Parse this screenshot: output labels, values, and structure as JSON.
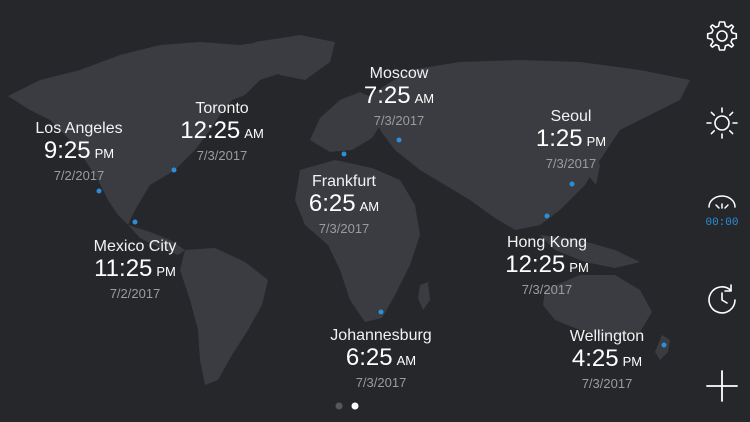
{
  "cities": [
    {
      "name": "Los Angeles",
      "time": "9:25",
      "ampm": "PM",
      "date": "7/2/2017"
    },
    {
      "name": "Toronto",
      "time": "12:25",
      "ampm": "AM",
      "date": "7/3/2017"
    },
    {
      "name": "Moscow",
      "time": "7:25",
      "ampm": "AM",
      "date": "7/3/2017"
    },
    {
      "name": "Seoul",
      "time": "1:25",
      "ampm": "PM",
      "date": "7/3/2017"
    },
    {
      "name": "Frankfurt",
      "time": "6:25",
      "ampm": "AM",
      "date": "7/3/2017"
    },
    {
      "name": "Mexico City",
      "time": "11:25",
      "ampm": "PM",
      "date": "7/2/2017"
    },
    {
      "name": "Hong Kong",
      "time": "12:25",
      "ampm": "PM",
      "date": "7/3/2017"
    },
    {
      "name": "Johannesburg",
      "time": "6:25",
      "ampm": "AM",
      "date": "7/3/2017"
    },
    {
      "name": "Wellington",
      "time": "4:25",
      "ampm": "PM",
      "date": "7/3/2017"
    }
  ],
  "sidebar": [
    {
      "icon": "gear-icon"
    },
    {
      "icon": "sun-icon"
    },
    {
      "icon": "digital-clock-icon"
    },
    {
      "icon": "sync-clock-icon"
    },
    {
      "icon": "plus-icon"
    }
  ],
  "pager": {
    "pages": 2,
    "current": 2
  },
  "colors": {
    "background": "#25272b",
    "land": "#3a3c41",
    "accent": "#2a8fd8",
    "text": "#ffffff",
    "subtext": "#9a9ca0"
  }
}
